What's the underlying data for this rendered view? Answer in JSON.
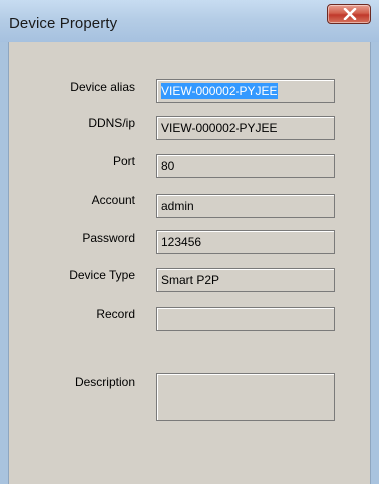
{
  "window": {
    "title": "Device Property"
  },
  "fields": {
    "device_alias": {
      "label": "Device alias",
      "value": "VIEW-000002-PYJEE"
    },
    "ddns_ip": {
      "label": "DDNS/ip",
      "value": "VIEW-000002-PYJEE"
    },
    "port": {
      "label": "Port",
      "value": "80"
    },
    "account": {
      "label": "Account",
      "value": "admin"
    },
    "password": {
      "label": "Password",
      "value": "123456"
    },
    "device_type": {
      "label": "Device Type",
      "value": "Smart P2P"
    },
    "record": {
      "label": "Record",
      "value": ""
    },
    "description": {
      "label": "Description",
      "value": ""
    }
  },
  "colors": {
    "titlebar": "#b5cde6",
    "dialog_background": "#d4d0c8",
    "selection_highlight": "#3399ff",
    "close_button": "#c0392b"
  },
  "icons": {
    "close": "close-icon"
  }
}
